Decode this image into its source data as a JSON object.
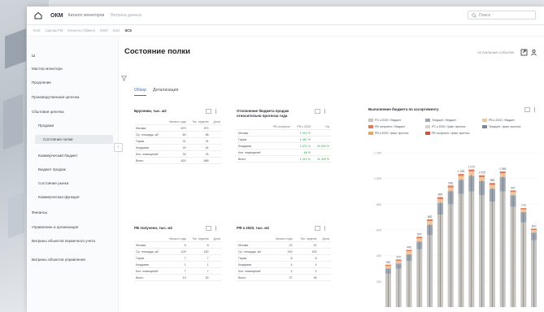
{
  "app": {
    "brand": "ОКМ",
    "crumbs": [
      "Каталог мониторов",
      "Витрина данных"
    ],
    "search_placeholder": "Поиск"
  },
  "subnav": [
    "EUS",
    "Сделки PM",
    "Клиенты (Обмен)",
    "ЕМО",
    "SAD",
    "SCS"
  ],
  "sidebar": {
    "items": [
      {
        "label": "Ш"
      },
      {
        "label": "Мастер монитора"
      },
      {
        "label": "Продление"
      },
      {
        "label": "Производственная цепочка"
      },
      {
        "label": "Сбытовая цепочка"
      },
      {
        "label": "Продажи"
      },
      {
        "label": "Состояние полки"
      },
      {
        "label": "Коммерческий бюджет"
      },
      {
        "label": "Бюджет продаж"
      },
      {
        "label": "Состояние рынка"
      },
      {
        "label": "Коммерческая функция"
      },
      {
        "label": "Финансы"
      },
      {
        "label": "Управление и организация"
      },
      {
        "label": "Витрины объектов первичного учета"
      },
      {
        "label": "Витрины объектов управления"
      }
    ]
  },
  "page": {
    "title": "Состояние полки",
    "actions_label": "Актуальные события",
    "tabs": [
      "Обзор",
      "Детализация"
    ]
  },
  "panels": {
    "p1": {
      "title": "Брусники, тыс. м2",
      "headers": [
        "",
        "Начало года",
        "Тек. неделю",
        "Доли"
      ],
      "rows": [
        [
          "Москва",
          "873",
          "973",
          ""
        ],
        [
          "Ср. площадь, м2",
          "60",
          "58",
          ""
        ],
        [
          "Гараж",
          "31",
          "31",
          ""
        ],
        [
          "Кладовая",
          "20",
          "24",
          ""
        ],
        [
          "Кол. помещений",
          "33",
          "33",
          ""
        ],
        [
          "Всего",
          "620",
          "658",
          ""
        ]
      ]
    },
    "p2": {
      "title": "Отклонение бюджета продаж относительно прогноза года",
      "headers": [
        "",
        "РВ получено",
        "РФ к 2020",
        "На"
      ],
      "rows": [
        [
          "Москва",
          "",
          "1 013 %",
          ""
        ],
        [
          "Гараж",
          "",
          "1 087 %",
          ""
        ],
        [
          "Кладовая",
          "",
          "1 671 %",
          "93 000 %"
        ],
        [
          "Кол. помещений",
          "",
          "68 %",
          ""
        ],
        [
          "Всего",
          "",
          "1 012 %",
          "11 425 %"
        ]
      ]
    },
    "p3": {
      "title": "РВ получено, тыс. м2",
      "headers": [
        "",
        "Начало года",
        "Тек. неделю",
        "Доли"
      ],
      "rows": [
        [
          "Москва",
          "8",
          "8",
          ""
        ],
        [
          "Ср. площадь, м2",
          "100",
          "100",
          ""
        ],
        [
          "Гараж",
          "7",
          "7",
          ""
        ],
        [
          "Кладовая",
          "1",
          "1",
          ""
        ],
        [
          "Кол. помещений",
          "7",
          "7",
          ""
        ],
        [
          "Всего",
          "19",
          "20",
          ""
        ]
      ]
    },
    "p4": {
      "title": "РФ к 2020, тыс. м2",
      "headers": [
        "",
        "Начало года",
        "Тек. неделю",
        "Доли"
      ],
      "rows": [
        [
          "Москва",
          "23",
          "24",
          ""
        ],
        [
          "Ср. площадь, м2",
          "100",
          "100",
          ""
        ],
        [
          "Гараж",
          "8",
          "8",
          ""
        ],
        [
          "Кладовая",
          "4",
          "4",
          ""
        ],
        [
          "Кол. помещений",
          "2",
          "2",
          ""
        ],
        [
          "Всего",
          "37",
          "38",
          ""
        ]
      ]
    }
  },
  "chart_data": {
    "type": "bar",
    "title": "Выполнение бюджета по ассортименту",
    "legend": [
      {
        "name": "РС к 2020 / бюджет",
        "color": "#c9c6c1"
      },
      {
        "name": "Текущее / бюджет",
        "color": "#9da6b1"
      },
      {
        "name": "РВ к 2020 / бюджет",
        "color": "#f0c79d"
      },
      {
        "name": "РВ получено / бюджет",
        "color": "#e07a5c"
      },
      {
        "name": "РС к 2020 / факт прогноз",
        "color": "#d8d4cd"
      },
      {
        "name": "Текущее / факт прогноз",
        "color": "#7b8794"
      },
      {
        "name": "РВ к 2020 / факт прогноз",
        "color": "#e6a86a"
      },
      {
        "name": "РВ получено / факт прогноз",
        "color": "#c9543b"
      }
    ],
    "yticks": [
      "1 200",
      "1 000",
      "800",
      "600",
      "400",
      "200"
    ],
    "ylim": [
      0,
      1200
    ],
    "series": [
      {
        "name": "РС к 2020 / бюджет",
        "values": [
          260,
          300,
          360,
          450,
          560,
          720,
          800,
          880,
          900,
          870,
          820,
          900,
          780,
          660,
          520
        ]
      },
      {
        "name": "Текущее / бюджет",
        "values": [
          40,
          40,
          50,
          60,
          80,
          90,
          100,
          110,
          120,
          110,
          100,
          110,
          90,
          80,
          60
        ]
      },
      {
        "name": "РВ к 2020 / бюджет",
        "values": [
          20,
          20,
          25,
          25,
          30,
          30,
          30,
          30,
          35,
          30,
          30,
          30,
          25,
          20,
          20
        ]
      },
      {
        "name": "РВ получено / бюджет",
        "values": [
          10,
          10,
          10,
          12,
          12,
          15,
          15,
          15,
          15,
          15,
          15,
          15,
          12,
          10,
          10
        ]
      }
    ],
    "totals": [
      "330",
      "370",
      "445",
      "547",
      "682",
      "855",
      "945",
      "1 035",
      "1 070",
      "1 025",
      "965",
      "1 055",
      "907",
      "770",
      "610"
    ]
  }
}
